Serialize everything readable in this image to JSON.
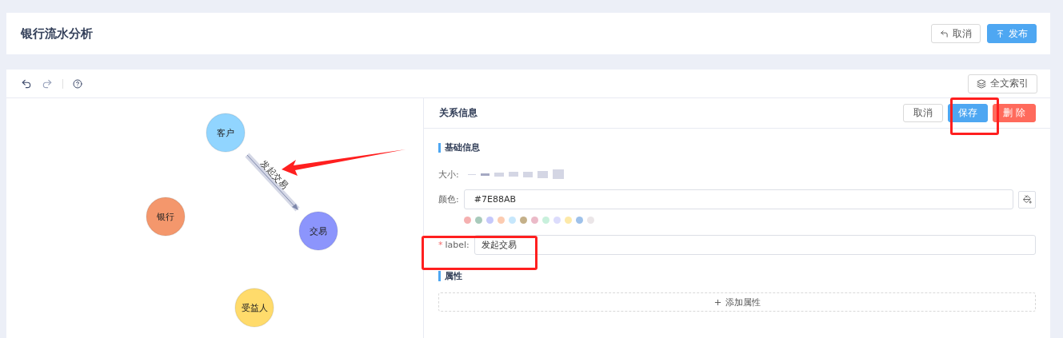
{
  "header": {
    "title": "银行流水分析",
    "buttons": [
      {
        "label": "取消",
        "kind": "default"
      },
      {
        "label": "发布",
        "kind": "primary"
      }
    ]
  },
  "toolbar": {
    "index_button": "全文索引"
  },
  "graph": {
    "nodes": [
      {
        "label": "客户",
        "color": "#91d5ff"
      },
      {
        "label": "银行",
        "color": "#f4976c"
      },
      {
        "label": "交易",
        "color": "#8c95fc"
      },
      {
        "label": "受益人",
        "color": "#ffdb6b"
      }
    ],
    "edges": [
      {
        "label": "发起交易",
        "selected": true
      }
    ]
  },
  "panel": {
    "title": "关系信息",
    "buttons": [
      {
        "label": "取消",
        "kind": "default"
      },
      {
        "label": "保存",
        "kind": "primary"
      },
      {
        "label": "删 除",
        "kind": "danger"
      }
    ],
    "section_basic": "基础信息",
    "size_label": "大小:",
    "sizes": [
      {
        "selected": false
      },
      {
        "selected": true
      },
      {
        "selected": false
      },
      {
        "selected": false
      },
      {
        "selected": false
      },
      {
        "selected": false
      },
      {
        "selected": false
      }
    ],
    "color_label": "颜色:",
    "color_value": "#7E88AB",
    "swatches": [
      {
        "color": "#f5b0b0"
      },
      {
        "color": "#a8cabb"
      },
      {
        "color": "#c5c8fb"
      },
      {
        "color": "#fccbb0"
      },
      {
        "color": "#c6e7fc"
      },
      {
        "color": "#c4b089"
      },
      {
        "color": "#ebbac8"
      },
      {
        "color": "#c8f0dc"
      },
      {
        "color": "#dcdcfc"
      },
      {
        "color": "#fde9a8"
      },
      {
        "color": "#9ec1ea"
      },
      {
        "color": "#ebe6e8"
      }
    ],
    "required_mark": "*",
    "label_label": "label:",
    "label_value": "发起交易",
    "section_props": "属性",
    "add_property": "添加属性"
  }
}
